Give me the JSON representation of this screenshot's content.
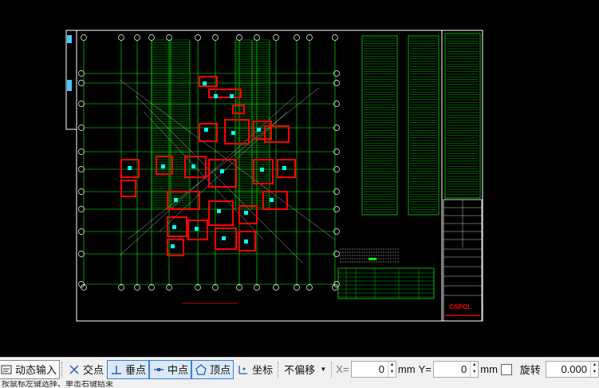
{
  "toolbar": {
    "dynamic_input": "动态输入",
    "intersection": "交点",
    "perpendicular": "垂点",
    "midpoint": "中点",
    "vertex": "顶点",
    "coordinate": "坐标",
    "offset_mode": "不偏移",
    "x_label": "X=",
    "x_value": "0",
    "x_unit": "mm",
    "y_label": "Y=",
    "y_value": "0",
    "y_unit": "mm",
    "rotate_label": "旋转",
    "rotate_value": "0.000"
  },
  "status": {
    "text": "按鼠标左键选择、单击右键结束"
  },
  "drawing": {
    "title_block_brand": "CAPOL",
    "colors": {
      "background": "#000000",
      "frame": "#ffffff",
      "axis": "#00ff00",
      "wall": "#ff0000",
      "column": "#00ffff",
      "table": "#00ff00"
    }
  }
}
